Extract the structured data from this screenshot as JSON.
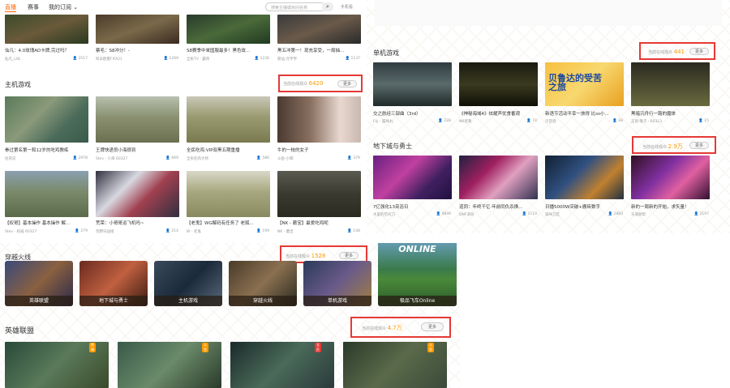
{
  "nav": {
    "tabs": [
      "直播",
      "赛事",
      "我的订阅 ⌄"
    ],
    "search_placeholder": "搜索主播或房间名称",
    "search_icon": "magnifier-icon",
    "mobile_label": "手机看"
  },
  "top_row": [
    {
      "title": "仙凡：4.0玫瑰AD卡牌,完过吗？",
      "author": "仙凡_LOL",
      "views": "3517"
    },
    {
      "title": "蔡毛：S8冲分！-",
      "author": "阿辛欧夏FIFA21",
      "views": "1269"
    },
    {
      "title": "S8赛季中单国服最多！黑色玫...",
      "author": "全民TV - 霸哥",
      "views": "1236"
    },
    {
      "title": "黑五冲第一！现充享受，一局抽...",
      "author": "蔡仙-元宇宇",
      "views": "1137"
    }
  ],
  "zhuji": {
    "title": "主机游戏",
    "online_label": "当前在线观众",
    "online_count": "6420",
    "more": "更多",
    "cards": [
      {
        "title": "拳过第名第一和12岁的吃鸡教练",
        "author": "拉风兄",
        "views": "2978"
      },
      {
        "title": "王牌快递员小海很到",
        "author": "Stev - 小海 60327",
        "views": "669"
      },
      {
        "title": "全民吃鸡:VIP双黑五期重播",
        "author": "全民吃鸡大师",
        "views": "586"
      },
      {
        "title": "牛的一枝的女子",
        "author": "斗鱼-小萌",
        "views": "379"
      },
      {
        "title": "【权哥】基本操作 基本操作 解...",
        "author": "Stev - 权威 60327",
        "views": "279"
      },
      {
        "title": "荒荣：小哥哥运飞机吗~",
        "author": "荒野乐园组",
        "views": "214"
      },
      {
        "title": "【老鬼】WG解码有任务了 老狐...",
        "author": "W - 老鬼",
        "views": "199"
      },
      {
        "title": "【NK - 蘑宝】最爱吃鸡呢",
        "author": "NK - 蘑宝",
        "views": "148"
      }
    ]
  },
  "chuanyue": {
    "title": "穿越火线",
    "online_label": "当前在线观众",
    "online_count": "1528",
    "more": "更多"
  },
  "categories": [
    "英雄联盟",
    "地下城与勇士",
    "主机游戏",
    "穿越火线",
    "单机游戏",
    "极品飞车Online"
  ],
  "right_top": [
    {
      "author": "",
      "views": ""
    },
    {
      "author": "",
      "views": ""
    },
    {
      "author": "",
      "views": ""
    },
    {
      "author": "",
      "views": ""
    }
  ],
  "danji": {
    "title": "单机游戏",
    "online_label": "当前在线观众",
    "online_count": "441",
    "more": "更多",
    "cards": [
      {
        "title": "交之航经三部曲（3rd）",
        "author": "Fly - 猫咪丸",
        "views": "228"
      },
      {
        "title": "《神秘海域4》炫耀声优食番观",
        "author": "NK老黄",
        "views": "74"
      },
      {
        "title": "新语节活动不幸一放得 比ss小...",
        "author": "贝音酒",
        "views": "28"
      },
      {
        "title": "黑暗沉舟行一路的魔体",
        "author": "正恩·敬子 · 60313",
        "views": "15"
      }
    ],
    "banner_text": "贝鲁达的受苦之旅"
  },
  "dixia": {
    "title": "地下城与勇士",
    "online_label": "当前在线观众",
    "online_count": "2.9万",
    "more": "更多",
    "cards": [
      {
        "title": "7亿强化13亮浴日",
        "author": "水里的空间刀",
        "views": "4849"
      },
      {
        "title": "道同：年终干亿·年前同仇杀换...",
        "author": "DNF道同",
        "views": "2119"
      },
      {
        "title": "日播5000W突破+搬砖数字",
        "author": "猫咪刀区",
        "views": "2883"
      },
      {
        "title": "新的一周新的开始，求矢量！",
        "author": "天道丽帮",
        "views": "2197"
      }
    ]
  },
  "lol": {
    "title": "英雄联盟",
    "online_label": "当前在线观众",
    "online_count": "4.7万",
    "more": "更多",
    "badges": [
      "前端",
      "斗鱼",
      "全民",
      "斗鱼"
    ]
  },
  "race_banner": "ONLINE",
  "colors": {
    "accent": "#ff6600",
    "highlight": "#e53935",
    "count": "#ff9900"
  }
}
